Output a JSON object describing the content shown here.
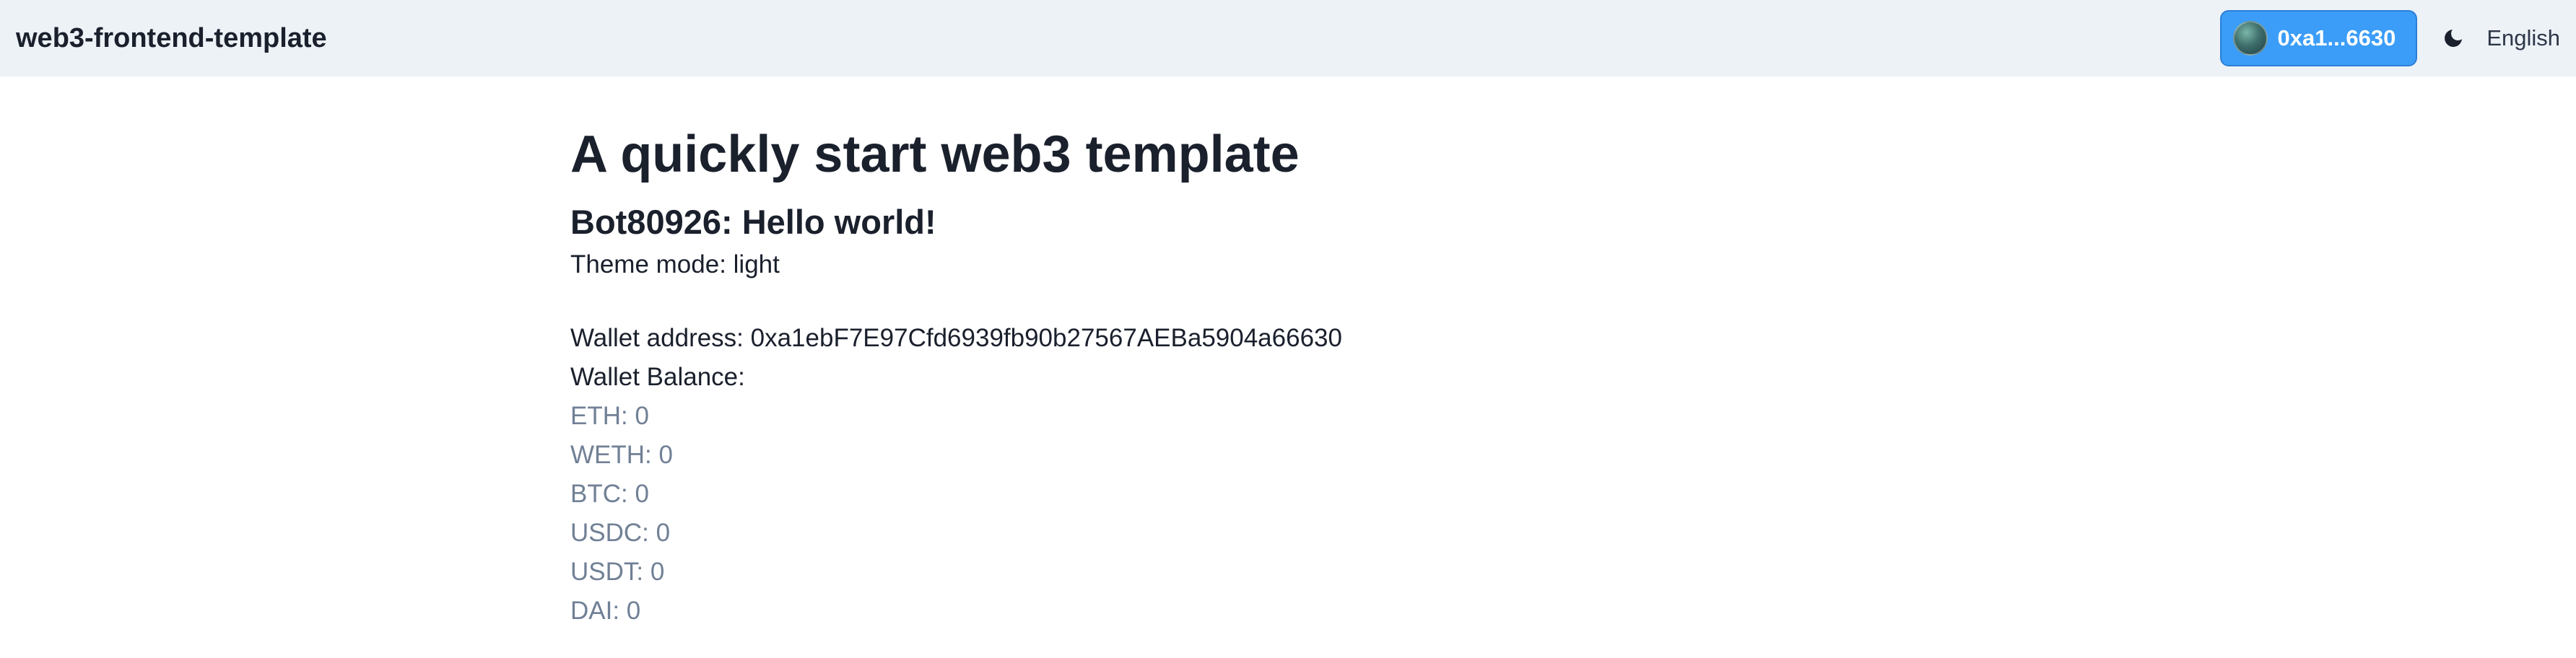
{
  "navbar": {
    "brand": "web3-frontend-template",
    "wallet_button_label": "0xa1...6630",
    "language": "English"
  },
  "main": {
    "title": "A quickly start web3 template",
    "greeting": "Bot80926: Hello world!",
    "theme_mode": "Theme mode: light",
    "wallet_address": "Wallet address: 0xa1ebF7E97Cfd6939fb90b27567AEBa5904a66630",
    "wallet_balance_label": "Wallet Balance:",
    "balances": [
      "ETH: 0",
      "WETH: 0",
      "BTC: 0",
      "USDC: 0",
      "USDT: 0",
      "DAI: 0"
    ]
  },
  "colors": {
    "navbar_bg": "#edf2f7",
    "wallet_button_bg": "#3b9df8",
    "token_text": "#718096"
  },
  "icons": {
    "theme_toggle": "moon-icon",
    "wallet_avatar": "avatar"
  }
}
